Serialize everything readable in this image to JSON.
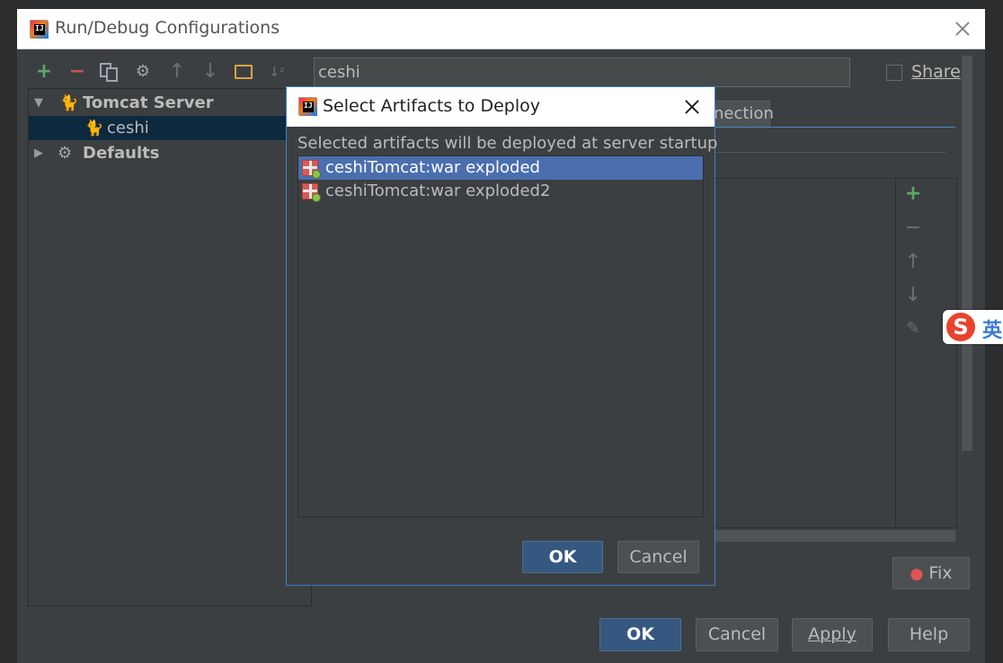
{
  "window": {
    "title": "Run/Debug Configurations",
    "share_label": "Share"
  },
  "toolbar": {
    "icons": [
      "add-icon",
      "remove-icon",
      "copy-icon",
      "edit-defaults-icon",
      "move-up-icon",
      "move-down-icon",
      "folder-icon",
      "sort-alphabetically-icon"
    ]
  },
  "tree": {
    "items": [
      {
        "label": "Tomcat Server",
        "icon": "tomcat-icon",
        "expanded": true
      },
      {
        "label": "ceshi",
        "icon": "tomcat-config-icon",
        "selected": true
      },
      {
        "label": "Defaults",
        "icon": "wrench-icon",
        "expanded": false
      }
    ]
  },
  "config": {
    "name_value": "ceshi",
    "partial_tab_label": "nection"
  },
  "side_actions": {
    "icons": [
      "add-icon",
      "remove-icon",
      "move-up-icon",
      "move-down-icon",
      "edit-icon"
    ]
  },
  "fix_button": {
    "label": "Fix"
  },
  "footer": {
    "ok_label": "OK",
    "cancel_label": "Cancel",
    "apply_label": "Apply",
    "help_label": "Help"
  },
  "dialog": {
    "title": "Select Artifacts to Deploy",
    "description": "Selected artifacts will be deployed at server startup",
    "artifacts": [
      {
        "label": "ceshiTomcat:war exploded",
        "selected": true
      },
      {
        "label": "ceshiTomcat:war exploded2",
        "selected": false
      }
    ],
    "ok_label": "OK",
    "cancel_label": "Cancel"
  },
  "ime": {
    "letter": "S",
    "label": "英"
  },
  "colors": {
    "panel_bg": "#3c3f41",
    "selection": "#4b6eaf",
    "tree_selection": "#0d293e",
    "default_button": "#365880",
    "add_green": "#59a869",
    "remove_red": "#c75450"
  }
}
